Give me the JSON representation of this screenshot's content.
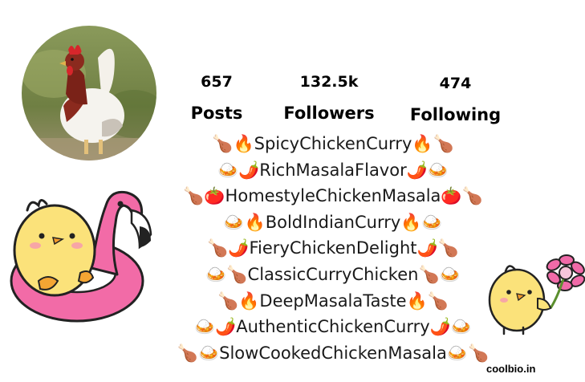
{
  "profile": {
    "avatar_icon": "rooster-photo",
    "stats": [
      {
        "value": "657",
        "label": "Posts"
      },
      {
        "value": "132.5k",
        "label": "Followers"
      },
      {
        "value": "474",
        "label": "Following"
      }
    ]
  },
  "bio": {
    "lines": [
      "🍗🔥SpicyChickenCurry🔥🍗",
      "🍛🌶️RichMasalaFlavor🌶️🍛",
      "🍗🍅HomestyleChickenMasala🍅🍗",
      "🍛🔥BoldIndianCurry🔥🍛",
      "🍗🌶️FieryChickenDelight🌶️🍗",
      "🍛🍗ClassicCurryChicken🍗🍛",
      "🍗🔥DeepMasalaTaste🔥🍗",
      "🍛🌶️AuthenticChickenCurry🌶️🍛",
      "🍗🍛SlowCookedChickenMasala🍛🍗"
    ]
  },
  "stickers": {
    "left": "chick-in-flamingo-float-sticker",
    "right": "chick-with-flower-sticker"
  },
  "watermark": "coolbio.in",
  "colors": {
    "flamingo_pink": "#f26ba7",
    "chick_yellow": "#fbe27a",
    "flower_pink": "#f06aa8"
  }
}
